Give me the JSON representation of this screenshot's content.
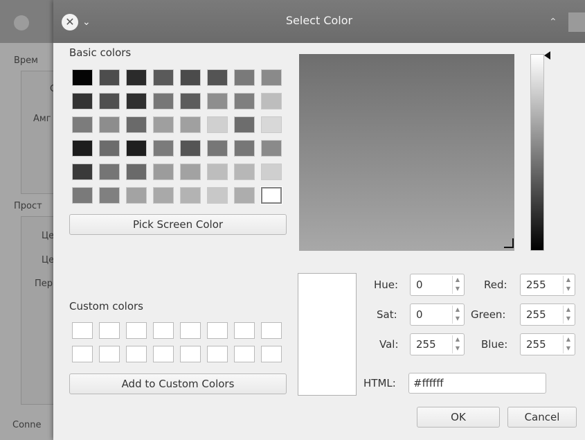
{
  "background": {
    "labels": [
      "Врем",
      "С",
      "Амг",
      "Прост",
      "Це",
      "Це",
      "Пер",
      "Conne"
    ]
  },
  "dialog": {
    "title": "Select Color",
    "close_glyph": "✕",
    "menu_glyph": "⌄",
    "keep_above_glyph": "⌃",
    "basic_colors_label": "Basic colors",
    "basic_colors": [
      "#050505",
      "#4d4d4d",
      "#2b2b2b",
      "#5a5a5a",
      "#4b4b4b",
      "#545454",
      "#7a7a7a",
      "#8a8a8a",
      "#333333",
      "#505050",
      "#2f2f2f",
      "#777777",
      "#5c5c5c",
      "#8e8e8e",
      "#7f7f7f",
      "#bdbdbd",
      "#7c7c7c",
      "#8d8d8d",
      "#6a6a6a",
      "#9f9f9f",
      "#a0a0a0",
      "#d0d0d0",
      "#6d6d6d",
      "#d8d8d8",
      "#1d1d1d",
      "#6c6c6c",
      "#1f1f1f",
      "#7b7b7b",
      "#555555",
      "#777777",
      "#777777",
      "#8a8a8a",
      "#3a3a3a",
      "#757575",
      "#6a6a6a",
      "#9c9c9c",
      "#a2a2a2",
      "#bdbdbd",
      "#b7b7b7",
      "#cfcfcf",
      "#7a7a7a",
      "#808080",
      "#a3a3a3",
      "#a9a9a9",
      "#b3b3b3",
      "#c8c8c8",
      "#adadad",
      "#ffffff"
    ],
    "selected_basic_index": 47,
    "pick_screen_button": "Pick Screen Color",
    "custom_colors_label": "Custom colors",
    "add_custom_button": "Add to Custom Colors",
    "fields": {
      "hue": {
        "label": "Hue:",
        "value": "0"
      },
      "sat": {
        "label": "Sat:",
        "value": "0"
      },
      "val": {
        "label": "Val:",
        "value": "255"
      },
      "red": {
        "label": "Red:",
        "value": "255"
      },
      "green": {
        "label": "Green:",
        "value": "255"
      },
      "blue": {
        "label": "Blue:",
        "value": "255"
      },
      "html": {
        "label": "HTML:",
        "value": "#ffffff"
      }
    },
    "ok_button": "OK",
    "cancel_button": "Cancel",
    "current_color": "#ffffff"
  }
}
